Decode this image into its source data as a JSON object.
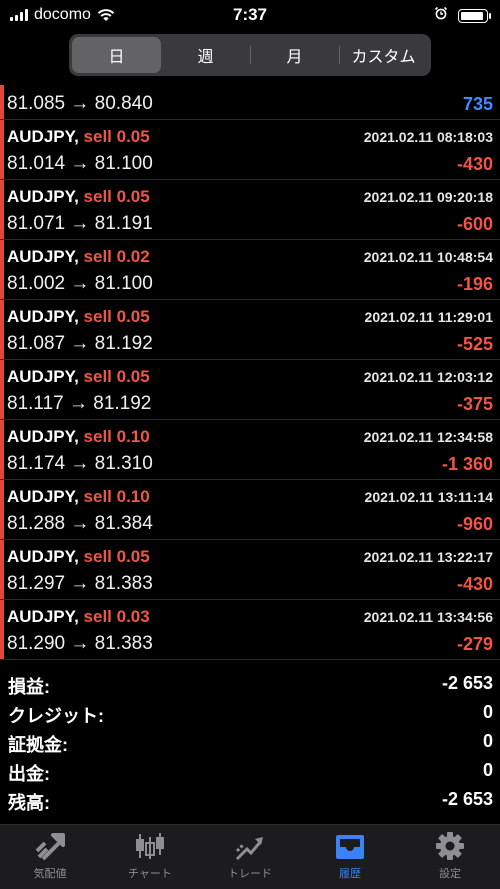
{
  "status_bar": {
    "carrier": "docomo",
    "time": "7:37"
  },
  "segment": {
    "items": [
      "日",
      "週",
      "月",
      "カスタム"
    ],
    "selected": "日"
  },
  "partial_row": {
    "prices": "81.085 → 80.840",
    "profit": "735"
  },
  "trades": [
    {
      "symbol": "AUDJPY,",
      "side": "sell 0.05",
      "date": "2021.02.11 08:18:03",
      "prices": "81.014 → 81.100",
      "profit": "-430"
    },
    {
      "symbol": "AUDJPY,",
      "side": "sell 0.05",
      "date": "2021.02.11 09:20:18",
      "prices": "81.071 → 81.191",
      "profit": "-600"
    },
    {
      "symbol": "AUDJPY,",
      "side": "sell 0.02",
      "date": "2021.02.11 10:48:54",
      "prices": "81.002 → 81.100",
      "profit": "-196"
    },
    {
      "symbol": "AUDJPY,",
      "side": "sell 0.05",
      "date": "2021.02.11 11:29:01",
      "prices": "81.087 → 81.192",
      "profit": "-525"
    },
    {
      "symbol": "AUDJPY,",
      "side": "sell 0.05",
      "date": "2021.02.11 12:03:12",
      "prices": "81.117 → 81.192",
      "profit": "-375"
    },
    {
      "symbol": "AUDJPY,",
      "side": "sell 0.10",
      "date": "2021.02.11 12:34:58",
      "prices": "81.174 → 81.310",
      "profit": "-1 360"
    },
    {
      "symbol": "AUDJPY,",
      "side": "sell 0.10",
      "date": "2021.02.11 13:11:14",
      "prices": "81.288 → 81.384",
      "profit": "-960"
    },
    {
      "symbol": "AUDJPY,",
      "side": "sell 0.05",
      "date": "2021.02.11 13:22:17",
      "prices": "81.297 → 81.383",
      "profit": "-430"
    },
    {
      "symbol": "AUDJPY,",
      "side": "sell 0.03",
      "date": "2021.02.11 13:34:56",
      "prices": "81.290 → 81.383",
      "profit": "-279"
    }
  ],
  "summary": [
    {
      "label": "損益:",
      "value": "-2 653"
    },
    {
      "label": "クレジット:",
      "value": "0"
    },
    {
      "label": "証拠金:",
      "value": "0"
    },
    {
      "label": "出金:",
      "value": "0"
    },
    {
      "label": "残高:",
      "value": "-2 653"
    }
  ],
  "tabs": [
    {
      "label": "気配値",
      "icon": "quotes-icon"
    },
    {
      "label": "チャート",
      "icon": "chart-icon"
    },
    {
      "label": "トレード",
      "icon": "trade-icon"
    },
    {
      "label": "履歴",
      "icon": "history-icon"
    },
    {
      "label": "設定",
      "icon": "settings-icon"
    }
  ],
  "active_tab": "履歴",
  "colors": {
    "sell": "#f05545",
    "loss": "#f05545",
    "profit": "#3f8cff",
    "accent": "#3b82f6",
    "background": "#000000"
  }
}
